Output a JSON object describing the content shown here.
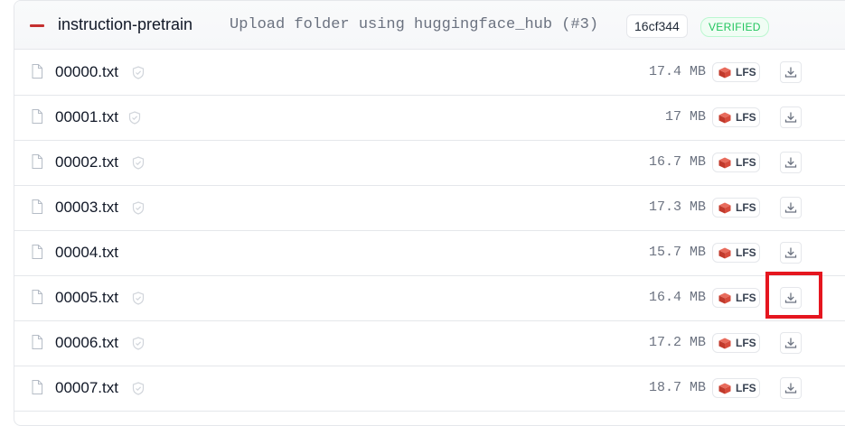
{
  "header": {
    "repo_name": "instruction-pretrain",
    "commit_message": "Upload folder using huggingface_hub (#3)",
    "commit_hash": "16cf344",
    "verified_badge": "VERIFIED"
  },
  "files": [
    {
      "name": "00000.txt",
      "size": "17.4 MB",
      "lfs": "LFS",
      "scanned": true
    },
    {
      "name": "00001.txt",
      "size": "17 MB",
      "lfs": "LFS",
      "scanned": true
    },
    {
      "name": "00002.txt",
      "size": "16.7 MB",
      "lfs": "LFS",
      "scanned": true
    },
    {
      "name": "00003.txt",
      "size": "17.3 MB",
      "lfs": "LFS",
      "scanned": true
    },
    {
      "name": "00004.txt",
      "size": "15.7 MB",
      "lfs": "LFS",
      "scanned": false
    },
    {
      "name": "00005.txt",
      "size": "16.4 MB",
      "lfs": "LFS",
      "scanned": true
    },
    {
      "name": "00006.txt",
      "size": "17.2 MB",
      "lfs": "LFS",
      "scanned": true
    },
    {
      "name": "00007.txt",
      "size": "18.7 MB",
      "lfs": "LFS",
      "scanned": true
    }
  ],
  "icons": {
    "org_logo": "org-logo-icon",
    "file": "file-icon",
    "shield": "shield-check-icon",
    "lfs": "lfs-cube-icon",
    "download": "download-icon"
  },
  "colors": {
    "highlight": "#e5161f",
    "verified": "#22c55e",
    "lfs_icon": "#d64b3c",
    "text_muted": "#6b7280"
  },
  "annotation": {
    "highlighted_row_index": 5,
    "highlighted_element": "download-button"
  }
}
